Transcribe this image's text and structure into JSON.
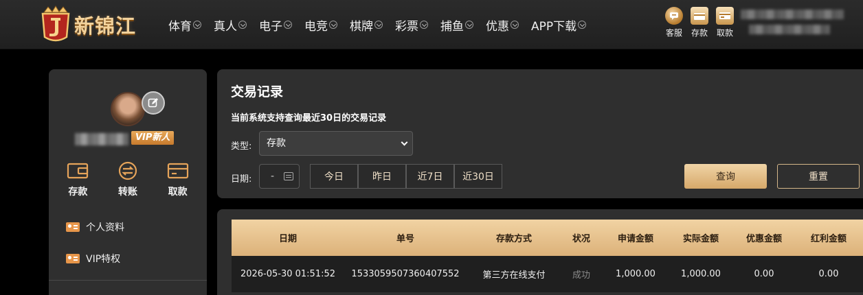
{
  "header": {
    "logo_text": "新锦江",
    "nav": [
      "体育",
      "真人",
      "电子",
      "电竞",
      "棋牌",
      "彩票",
      "捕鱼",
      "优惠",
      "APP下载"
    ],
    "quick_actions": [
      {
        "label": "客服",
        "icon": "chat-icon"
      },
      {
        "label": "存款",
        "icon": "wallet-icon"
      },
      {
        "label": "取款",
        "icon": "card-icon"
      }
    ]
  },
  "sidebar": {
    "vip_label": "VIP新人",
    "actions": [
      {
        "label": "存款",
        "icon": "wallet-icon"
      },
      {
        "label": "转账",
        "icon": "transfer-icon"
      },
      {
        "label": "取款",
        "icon": "card-icon"
      }
    ],
    "menu": [
      {
        "label": "个人资料",
        "icon": "id-card-icon"
      },
      {
        "label": "VIP特权",
        "icon": "vip-card-icon"
      }
    ]
  },
  "filter": {
    "title": "交易记录",
    "subtitle": "当前系统支持查询最近30日的交易记录",
    "type_label": "类型:",
    "type_value": "存款",
    "date_label": "日期:",
    "date_value": "-",
    "ranges": [
      "今日",
      "昨日",
      "近7日",
      "近30日"
    ],
    "query_label": "查询",
    "reset_label": "重置"
  },
  "table": {
    "columns": [
      "日期",
      "单号",
      "存款方式",
      "状况",
      "申请金额",
      "实际金额",
      "优惠金额",
      "红利金额"
    ],
    "rows": [
      [
        "2026-05-30 01:51:52",
        "1533059507360407552",
        "第三方在线支付",
        "成功",
        "1,000.00",
        "1,000.00",
        "0.00",
        "0.00"
      ]
    ]
  },
  "colors": {
    "accent_gold": "#dcb179",
    "panel_bg": "#2f2f2f",
    "vip_orange": "#e8a95b"
  }
}
